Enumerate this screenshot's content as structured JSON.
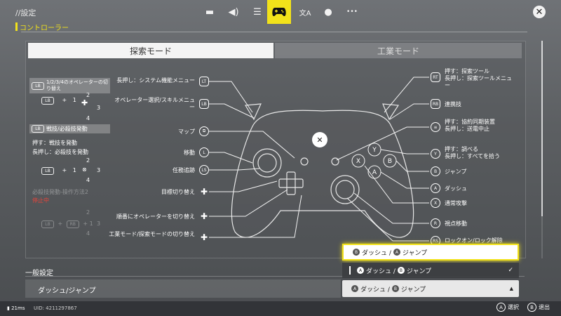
{
  "header": {
    "title": "//設定",
    "section": "コントローラー",
    "nav": [
      {
        "name": "display-icon",
        "glyph": "▬"
      },
      {
        "name": "sound-icon",
        "glyph": "◀)"
      },
      {
        "name": "sliders-icon",
        "glyph": "☰"
      },
      {
        "name": "gamepad-icon",
        "glyph": "🎮"
      },
      {
        "name": "language-icon",
        "glyph": "文A"
      },
      {
        "name": "account-icon",
        "glyph": "●"
      },
      {
        "name": "more-icon",
        "glyph": "•••"
      }
    ],
    "close": "✕"
  },
  "tabs": {
    "explore": "探索モード",
    "industry": "工業モード"
  },
  "left": {
    "h1_badge": "LB",
    "h1": "1/2/3/4のオペレーターの切り替え",
    "combo1_a": "LB",
    "plus": "+",
    "combo1_b": "1",
    "combo1_n": [
      "2",
      "3",
      "4"
    ],
    "h2_badge": "LB",
    "h2": "戦技/必殺技発動",
    "press": "押す：戦技を発動",
    "hold": "長押し：必殺技を発動",
    "combo2_a": "LB",
    "combo2_b": "1",
    "combo2_n": [
      "2",
      "3",
      "4"
    ],
    "alt_title": "必殺技発動-操作方法2",
    "alt_status": "停止中",
    "combo3_a": "LB",
    "combo3_c": "RB",
    "combo3_b": "1",
    "combo3_n": [
      "2",
      "3",
      "4"
    ]
  },
  "callouts_left": [
    {
      "text": "長押し：システム機能メニュー",
      "key": "LT"
    },
    {
      "text": "オペレーター選択/スキルメニュー",
      "key": "LB"
    },
    {
      "text": "マップ",
      "key": "⧉"
    },
    {
      "text": "移動",
      "key": "L"
    },
    {
      "text": "任務追跡",
      "key": "LS"
    },
    {
      "text": "目標切り替え",
      "key": "✚"
    },
    {
      "text": "順番にオペレーターを切り替え",
      "key": "✚"
    },
    {
      "text": "工業モード/探索モードの切り替え",
      "key": "✚"
    }
  ],
  "callouts_right": [
    {
      "text": "押す：探索ツール\n長押し：探索ツールメニュー",
      "key": "RT"
    },
    {
      "text": "連携技",
      "key": "RB"
    },
    {
      "text": "押す：協約同期装置\n長押し：送電中止",
      "key": "≡"
    },
    {
      "text": "押す：調べる\n長押し：すべてを拾う",
      "key": "Y"
    },
    {
      "text": "ジャンプ",
      "key": "B"
    },
    {
      "text": "ダッシュ",
      "key": "A"
    },
    {
      "text": "通常攻撃",
      "key": "X"
    },
    {
      "text": "視点移動",
      "key": "R"
    },
    {
      "text": "ロックオン/ロック解除",
      "key": "RS"
    }
  ],
  "general": {
    "label": "一般設定",
    "row": "ダッシュ/ジャンプ"
  },
  "dropdown": {
    "opt1": {
      "a": "B",
      "sep": "ダッシュ /",
      "b": "A",
      "tail": "ジャンプ"
    },
    "opt2": {
      "a": "A",
      "sep": "ダッシュ /",
      "b": "B",
      "tail": "ジャンプ",
      "check": "✓"
    },
    "selected": {
      "a": "A",
      "sep": "ダッシュ /",
      "b": "B",
      "tail": "ジャンプ",
      "arrow": "▲"
    }
  },
  "footer": {
    "ping": "21ms",
    "uid": "UID: 4211297867",
    "select_key": "A",
    "select": "選択",
    "back_key": "B",
    "back": "退出"
  }
}
